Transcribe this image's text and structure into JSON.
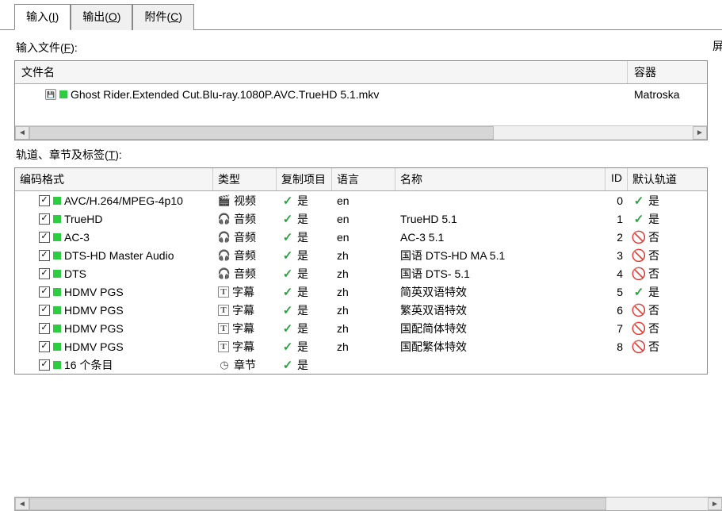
{
  "tabs": [
    {
      "label": "输入",
      "key": "I",
      "active": true
    },
    {
      "label": "输出",
      "key": "O",
      "active": false
    },
    {
      "label": "附件",
      "key": "C",
      "active": false
    }
  ],
  "input_files_label": "输入文件(",
  "input_files_key": "F",
  "input_files_label_end": "):",
  "side_cut": "屏",
  "file_columns": {
    "filename": "文件名",
    "container": "容器"
  },
  "files": [
    {
      "name": "Ghost Rider.Extended Cut.Blu-ray.1080P.AVC.TrueHD 5.1.mkv",
      "container": "Matroska"
    }
  ],
  "tracks_label": "轨道、章节及标签(",
  "tracks_key": "T",
  "tracks_label_end": "):",
  "track_columns": {
    "codec": "编码格式",
    "type": "类型",
    "copy": "复制项目",
    "lang": "语言",
    "name": "名称",
    "id": "ID",
    "def": "默认轨道"
  },
  "yes": "是",
  "no": "否",
  "type_labels": {
    "video": "视频",
    "audio": "音频",
    "subtitle": "字幕",
    "chapter": "章节"
  },
  "tracks": [
    {
      "codec": "AVC/H.264/MPEG-4p10",
      "type": "video",
      "copy": true,
      "lang": "en",
      "name": "",
      "id": 0,
      "def": true
    },
    {
      "codec": "TrueHD",
      "type": "audio",
      "copy": true,
      "lang": "en",
      "name": "TrueHD 5.1",
      "id": 1,
      "def": true
    },
    {
      "codec": "AC-3",
      "type": "audio",
      "copy": true,
      "lang": "en",
      "name": "AC-3 5.1",
      "id": 2,
      "def": false
    },
    {
      "codec": "DTS-HD Master Audio",
      "type": "audio",
      "copy": true,
      "lang": "zh",
      "name": "国语 DTS-HD MA 5.1",
      "id": 3,
      "def": false
    },
    {
      "codec": "DTS",
      "type": "audio",
      "copy": true,
      "lang": "zh",
      "name": "国语 DTS- 5.1",
      "id": 4,
      "def": false
    },
    {
      "codec": "HDMV PGS",
      "type": "subtitle",
      "copy": true,
      "lang": "zh",
      "name": "简英双语特效",
      "id": 5,
      "def": true
    },
    {
      "codec": "HDMV PGS",
      "type": "subtitle",
      "copy": true,
      "lang": "zh",
      "name": "繁英双语特效",
      "id": 6,
      "def": false
    },
    {
      "codec": "HDMV PGS",
      "type": "subtitle",
      "copy": true,
      "lang": "zh",
      "name": "国配简体特效",
      "id": 7,
      "def": false
    },
    {
      "codec": "HDMV PGS",
      "type": "subtitle",
      "copy": true,
      "lang": "zh",
      "name": "国配繁体特效",
      "id": 8,
      "def": false
    },
    {
      "codec": "16 个条目",
      "type": "chapter",
      "copy": true,
      "lang": "",
      "name": "",
      "id": "",
      "def": ""
    }
  ],
  "type_icons": {
    "video": "🎬",
    "audio": "🎧",
    "subtitle": "T",
    "chapter": "◷"
  }
}
